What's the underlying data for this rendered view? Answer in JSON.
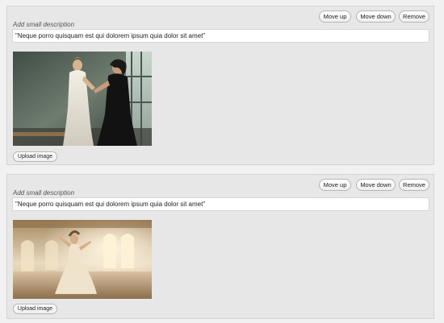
{
  "items": [
    {
      "buttons": {
        "move_up": "Move up",
        "move_down": "Move down",
        "remove": "Remove"
      },
      "description_label": "Add small description",
      "description_value": "\"Neque porro quisquam est qui dolorem ipsum quia dolor sit amet\"",
      "upload_label": "Upload image"
    },
    {
      "buttons": {
        "move_up": "Move up",
        "move_down": "Move down",
        "remove": "Remove"
      },
      "description_label": "Add small description",
      "description_value": "\"Neque porro quisquam est qui dolorem ipsum quia dolor sit amet\"",
      "upload_label": "Upload image"
    }
  ]
}
